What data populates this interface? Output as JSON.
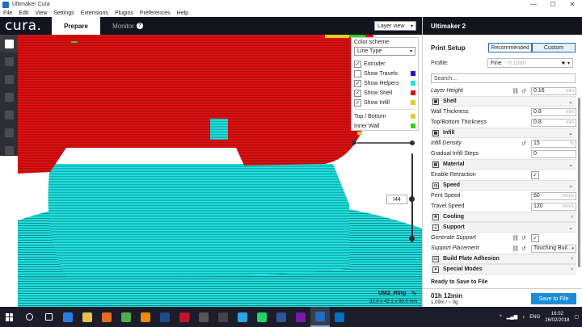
{
  "window": {
    "title": "Ultimaker Cura",
    "controls": [
      "—",
      "☐",
      "✕"
    ]
  },
  "menu": [
    "File",
    "Edit",
    "View",
    "Settings",
    "Extensions",
    "Plugins",
    "Preferences",
    "Help"
  ],
  "header": {
    "logo": "cura.",
    "tab_prepare": "Prepare",
    "tab_monitor": "Monitor",
    "monitor_badge": "?"
  },
  "view_select": {
    "value": "Layer view"
  },
  "color_scheme": {
    "title": "Color scheme",
    "value": "Line Type",
    "options": [
      {
        "label": "Extruder",
        "checked": true,
        "color": ""
      },
      {
        "label": "Show Travels",
        "checked": false,
        "color": "#1a1ad0"
      },
      {
        "label": "Show Helpers",
        "checked": true,
        "color": "#1ee0e0"
      },
      {
        "label": "Show Shell",
        "checked": true,
        "color": "#e01010"
      },
      {
        "label": "Show Infill",
        "checked": true,
        "color": "#e0d020"
      }
    ],
    "legend": [
      {
        "label": "Top / Bottom",
        "color": "#e0d020"
      },
      {
        "label": "Inner Wall",
        "color": "#30d020"
      }
    ]
  },
  "layer": {
    "number": "!44"
  },
  "model": {
    "name": "UM2_Ring",
    "dims": "32.0 x 42.1 x 98.0 mm"
  },
  "panel": {
    "printer": "Ultimaker 2",
    "print_setup": "Print Setup",
    "mode_recommended": "Recommended",
    "mode_custom": "Custom",
    "profile_label": "Profile:",
    "profile_value": "Fine",
    "profile_sub": "- 0.1mm",
    "search": "Search...",
    "layer_height": {
      "label": "Layer Height",
      "value": "0.16",
      "unit": "mm"
    },
    "shell": "Shell",
    "wall_thickness": {
      "label": "Wall Thickness",
      "value": "0.8",
      "unit": "mm"
    },
    "topbottom_thickness": {
      "label": "Top/Bottom Thickness",
      "value": "0.8",
      "unit": "mm"
    },
    "infill": "Infill",
    "infill_density": {
      "label": "Infill Density",
      "value": "15",
      "unit": "%"
    },
    "gradual_infill": {
      "label": "Gradual Infill Steps",
      "value": "0"
    },
    "material": "Material",
    "enable_retraction": {
      "label": "Enable Retraction",
      "checked": true
    },
    "speed": "Speed",
    "print_speed": {
      "label": "Print Speed",
      "value": "60",
      "unit": "mm/s"
    },
    "travel_speed": {
      "label": "Travel Speed",
      "value": "120",
      "unit": "mm/s"
    },
    "cooling": "Cooling",
    "support": "Support",
    "generate_support": {
      "label": "Generate Support",
      "checked": true
    },
    "support_placement": {
      "label": "Support Placement",
      "value": "Touching Buil..."
    },
    "adhesion": "Build Plate Adhesion",
    "special_modes": "Special Modes",
    "ready": "Ready to Save to File",
    "time": "01h 12min",
    "material_usage": "1.09m / ~ 0g",
    "save_button": "Save to File"
  },
  "taskbar": {
    "icons": [
      {
        "name": "search",
        "color": "#ffffff"
      },
      {
        "name": "task-view",
        "color": "#ffffff"
      },
      {
        "name": "edge",
        "color": "#2a7de1"
      },
      {
        "name": "explorer",
        "color": "#e8c04a"
      },
      {
        "name": "firefox",
        "color": "#e66a1f"
      },
      {
        "name": "chrome",
        "color": "#4caf50"
      },
      {
        "name": "vlc",
        "color": "#f08a00"
      },
      {
        "name": "photoshop",
        "color": "#1b4b8a"
      },
      {
        "name": "acrobat",
        "color": "#c8102e"
      },
      {
        "name": "calculator",
        "color": "#555555"
      },
      {
        "name": "camera",
        "color": "#444444"
      },
      {
        "name": "telegram",
        "color": "#2ca5e0"
      },
      {
        "name": "whatsapp",
        "color": "#25d366"
      },
      {
        "name": "word",
        "color": "#2b579a"
      },
      {
        "name": "onenote",
        "color": "#7719aa"
      },
      {
        "name": "cura",
        "color": "#1a6fc4"
      },
      {
        "name": "outlook",
        "color": "#0072c6"
      }
    ],
    "lang": "ENG",
    "time": "16:02",
    "date": "26/02/2018"
  }
}
